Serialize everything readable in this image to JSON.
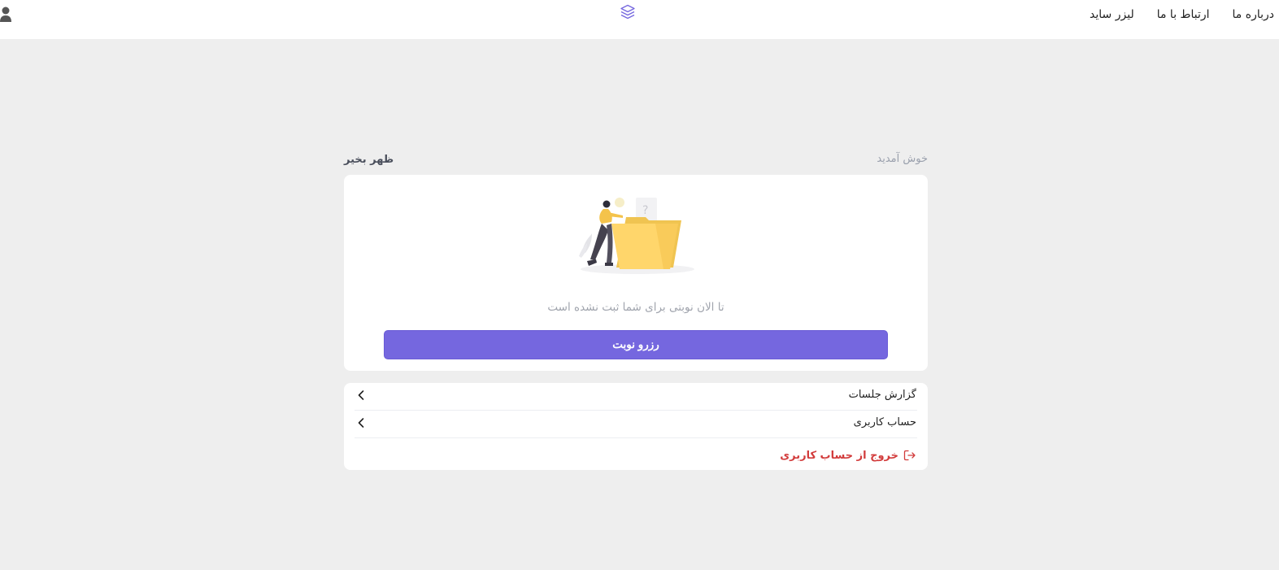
{
  "header": {
    "nav_items": [
      {
        "label": "لیزر ساید"
      },
      {
        "label": "ارتباط با ما"
      },
      {
        "label": "درباره ما"
      }
    ],
    "logo_icon": "layers-icon",
    "user_icon": "user-icon"
  },
  "greeting": {
    "welcome": "خوش آمدید",
    "name": "ظهر بخیر"
  },
  "appointments": {
    "illustration": "empty-folder-illustration",
    "empty_message": "تا الان نوبتی برای شما ثبت نشده است",
    "book_button": "رزرو نوبت"
  },
  "menu": {
    "items": [
      {
        "label": "گزارش جلسات",
        "icon": "chevron-left-icon"
      },
      {
        "label": "حساب کاربری",
        "icon": "chevron-left-icon"
      }
    ],
    "logout": {
      "label": "خروج از حساب کاربری",
      "icon": "logout-icon"
    }
  },
  "colors": {
    "accent": "#7567df",
    "danger": "#d23c3c",
    "background": "#eeeeee"
  }
}
